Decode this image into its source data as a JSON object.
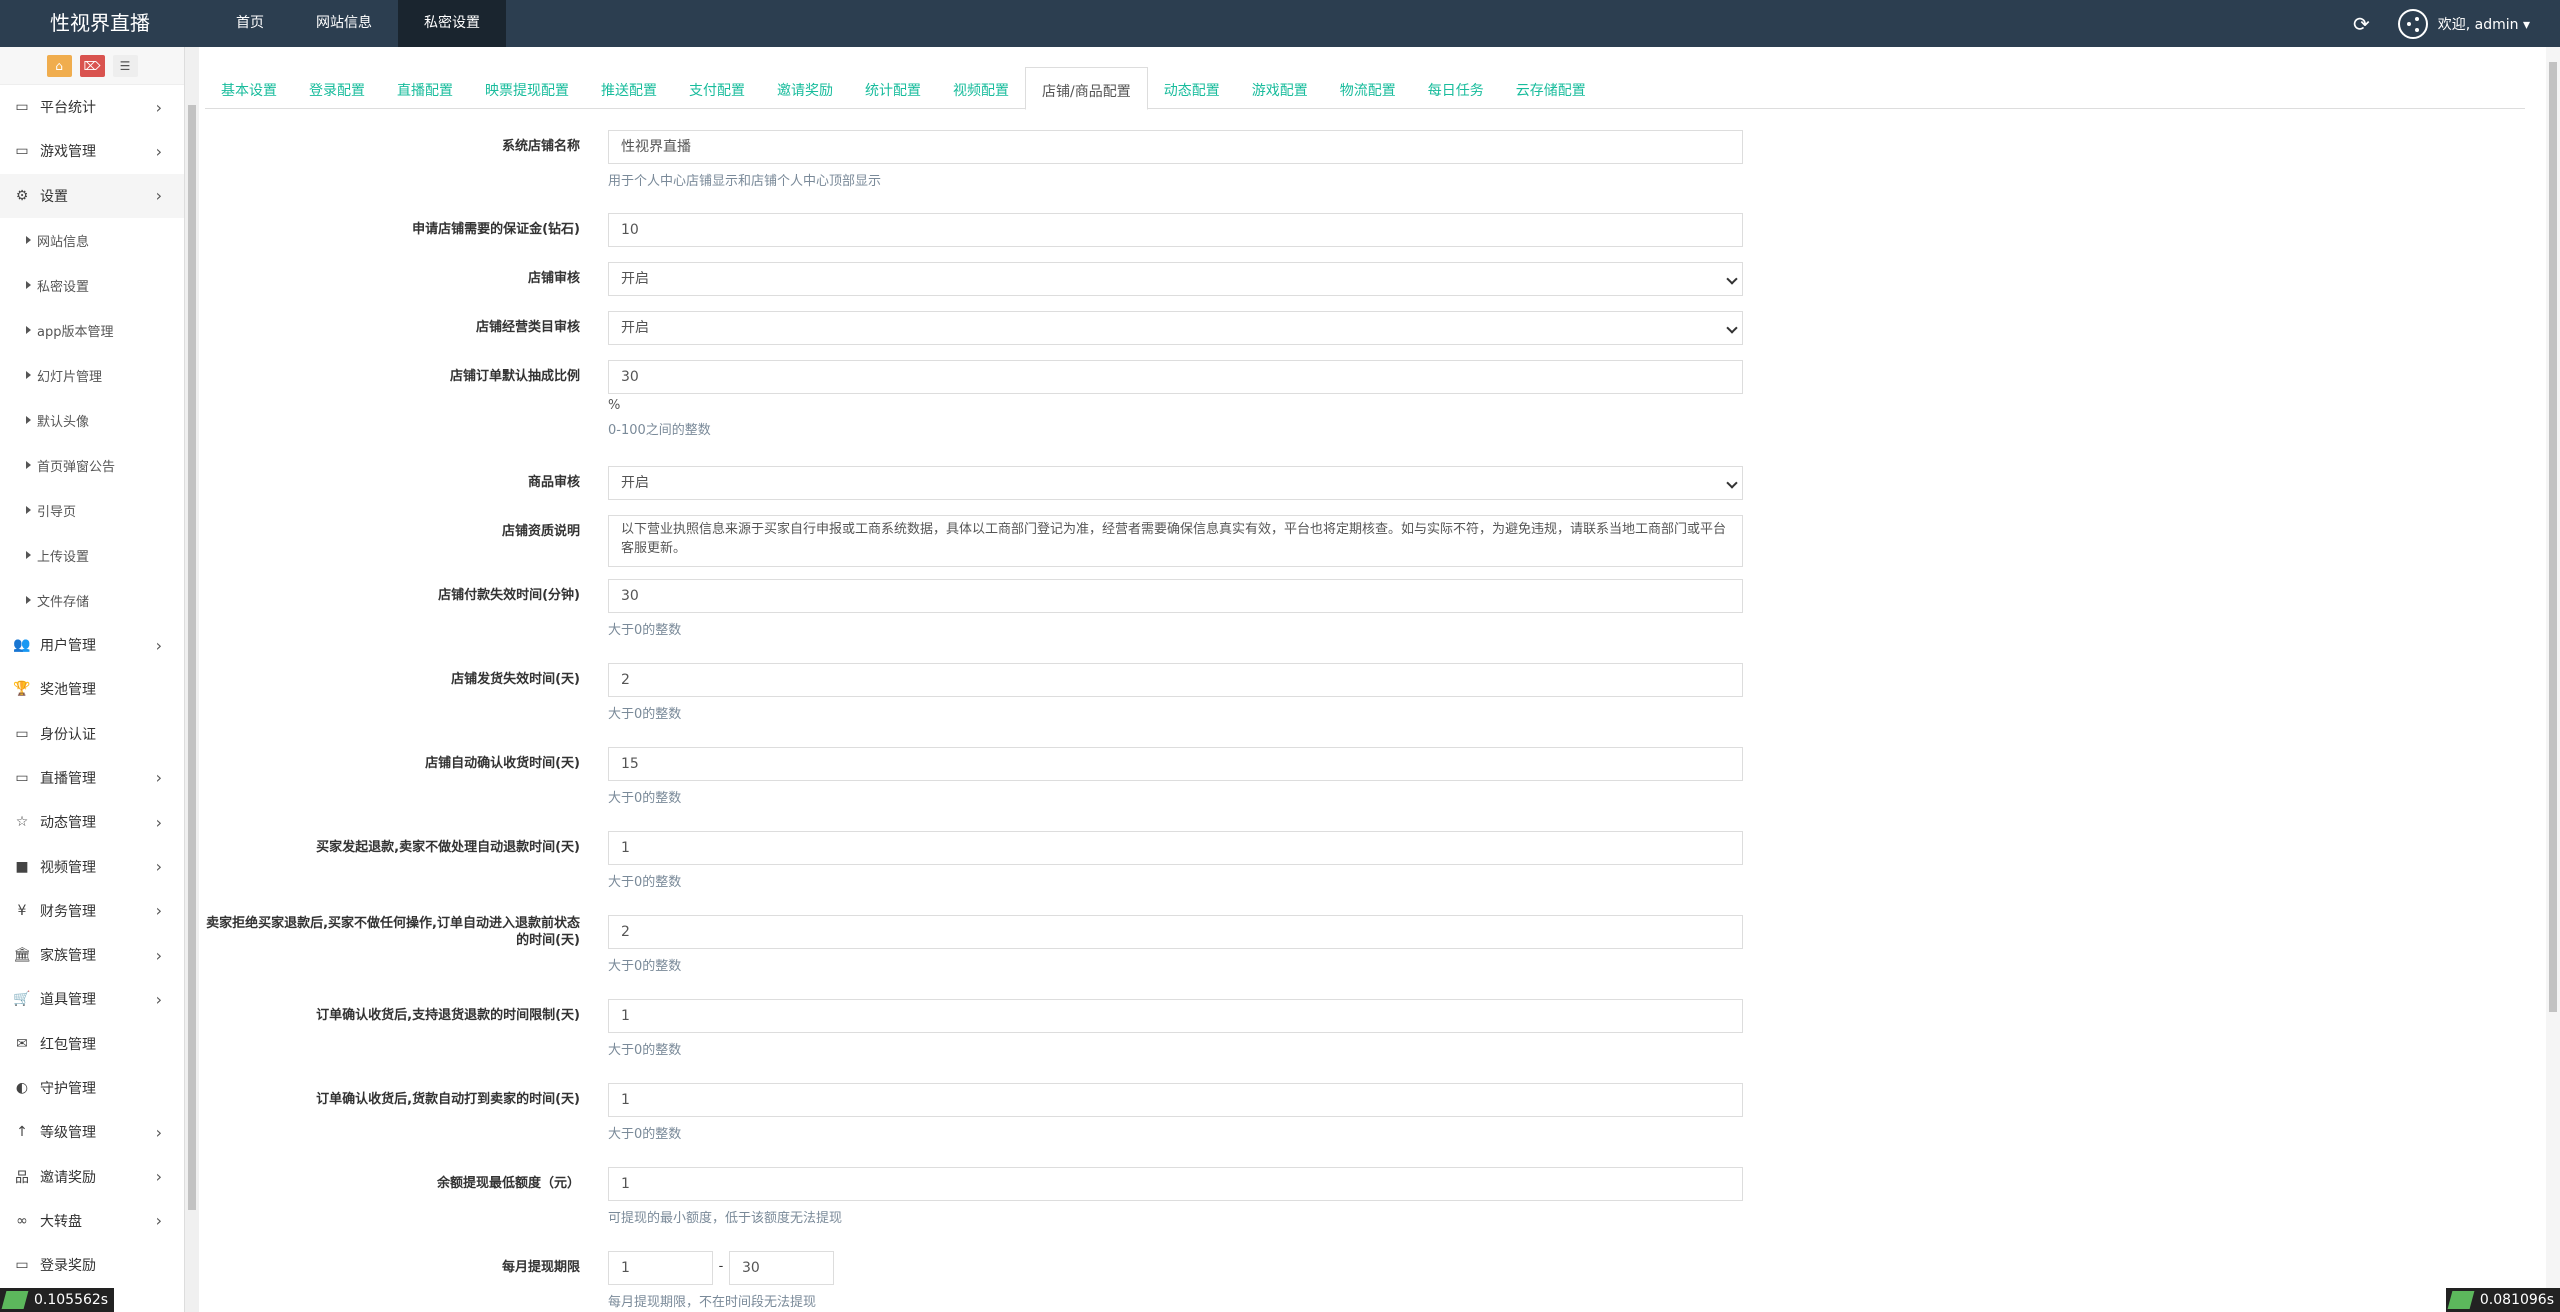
{
  "brand": "性视界直播",
  "topnav": [
    {
      "label": "首页"
    },
    {
      "label": "网站信息"
    },
    {
      "label": "私密设置"
    }
  ],
  "user": {
    "welcome": "欢迎, admin ▾"
  },
  "sidebar": {
    "tools": [
      "⌂",
      "⌦",
      "☰"
    ],
    "items": [
      {
        "label": "平台统计",
        "icon": "▭",
        "chevron": "›"
      },
      {
        "label": "游戏管理",
        "icon": "▭",
        "chevron": "›"
      },
      {
        "label": "设置",
        "icon": "⚙",
        "chevron": "›"
      },
      {
        "label": "用户管理",
        "icon": "👥",
        "chevron": "›"
      },
      {
        "label": "奖池管理",
        "icon": "🏆"
      },
      {
        "label": "身份认证",
        "icon": "▭"
      },
      {
        "label": "直播管理",
        "icon": "▭",
        "chevron": "›"
      },
      {
        "label": "动态管理",
        "icon": "☆",
        "chevron": "›"
      },
      {
        "label": "视频管理",
        "icon": "■",
        "chevron": "›"
      },
      {
        "label": "财务管理",
        "icon": "¥",
        "chevron": "›"
      },
      {
        "label": "家族管理",
        "icon": "🏛",
        "chevron": "›"
      },
      {
        "label": "道具管理",
        "icon": "🛒",
        "chevron": "›"
      },
      {
        "label": "红包管理",
        "icon": "✉"
      },
      {
        "label": "守护管理",
        "icon": "◐"
      },
      {
        "label": "等级管理",
        "icon": "↑",
        "chevron": "›"
      },
      {
        "label": "邀请奖励",
        "icon": "品",
        "chevron": "›"
      },
      {
        "label": "大转盘",
        "icon": "∞",
        "chevron": "›"
      },
      {
        "label": "登录奖励",
        "icon": "▭"
      }
    ],
    "sub_items": [
      "网站信息",
      "私密设置",
      "app版本管理",
      "幻灯片管理",
      "默认头像",
      "首页弹窗公告",
      "引导页",
      "上传设置",
      "文件存储"
    ]
  },
  "tabs": [
    "基本设置",
    "登录配置",
    "直播配置",
    "映票提现配置",
    "推送配置",
    "支付配置",
    "邀请奖励",
    "统计配置",
    "视频配置",
    "店铺/商品配置",
    "动态配置",
    "游戏配置",
    "物流配置",
    "每日任务",
    "云存储配置"
  ],
  "form": {
    "shop_name": {
      "label": "系统店铺名称",
      "value": "性视界直播",
      "help": "用于个人中心店铺显示和店铺个人中心顶部显示"
    },
    "deposit": {
      "label": "申请店铺需要的保证金(钻石)",
      "value": "10"
    },
    "shop_audit": {
      "label": "店铺审核",
      "value": "开启"
    },
    "category_audit": {
      "label": "店铺经营类目审核",
      "value": "开启"
    },
    "commission": {
      "label": "店铺订单默认抽成比例",
      "value": "30",
      "unit": "%",
      "help": "0-100之间的整数"
    },
    "goods_audit": {
      "label": "商品审核",
      "value": "开启"
    },
    "qualification": {
      "label": "店铺资质说明",
      "value": "以下营业执照信息来源于买家自行申报或工商系统数据，具体以工商部门登记为准，经营者需要确保信息真实有效，平台也将定期核查。如与实际不符，为避免违规，请联系当地工商部门或平台客服更新。"
    },
    "pay_timeout": {
      "label": "店铺付款失效时间(分钟)",
      "value": "30",
      "help": "大于0的整数"
    },
    "ship_timeout": {
      "label": "店铺发货失效时间(天)",
      "value": "2",
      "help": "大于0的整数"
    },
    "auto_confirm": {
      "label": "店铺自动确认收货时间(天)",
      "value": "15",
      "help": "大于0的整数"
    },
    "refund_auto": {
      "label": "买家发起退款,卖家不做处理自动退款时间(天)",
      "value": "1",
      "help": "大于0的整数"
    },
    "refund_reject": {
      "label": "卖家拒绝买家退款后,买家不做任何操作,订单自动进入退款前状态的时间(天)",
      "value": "2",
      "help": "大于0的整数"
    },
    "return_limit": {
      "label": "订单确认收货后,支持退货退款的时间限制(天)",
      "value": "1",
      "help": "大于0的整数"
    },
    "payout_time": {
      "label": "订单确认收货后,货款自动打到卖家的时间(天)",
      "value": "1",
      "help": "大于0的整数"
    },
    "min_withdraw": {
      "label": "余额提现最低额度（元）",
      "value": "1",
      "help": "可提现的最小额度，低于该额度无法提现"
    },
    "withdraw_period": {
      "label": "每月提现期限",
      "from": "1",
      "sep": "-",
      "to": "30",
      "help": "每月提现期限，不在时间段无法提现"
    }
  },
  "timers": {
    "left": "0.105562s",
    "right": "0.081096s"
  }
}
